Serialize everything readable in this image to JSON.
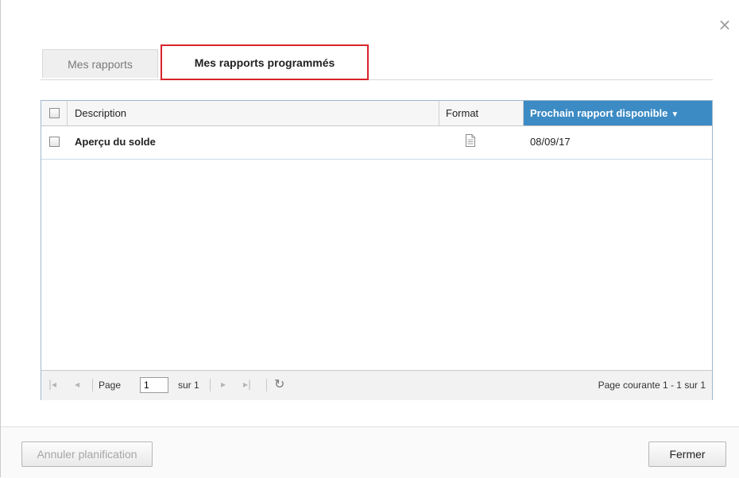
{
  "dialog": {
    "close_glyph": "×"
  },
  "tabs": [
    {
      "label": "Mes rapports",
      "active": false
    },
    {
      "label": "Mes rapports programmés",
      "active": true
    }
  ],
  "grid": {
    "columns": {
      "description": "Description",
      "format": "Format",
      "next_report": "Prochain rapport disponible",
      "sort_glyph": "▼"
    },
    "rows": [
      {
        "description": "Aperçu du solde",
        "format_icon": "document-icon",
        "next_report": "08/09/17",
        "checked": false
      }
    ]
  },
  "pager": {
    "first_glyph": "|◂",
    "prev_glyph": "◂",
    "next_glyph": "▸",
    "last_glyph": "▸|",
    "refresh_glyph": "↻",
    "page_label": "Page",
    "page_value": "1",
    "of_label": "sur 1",
    "info": "Page courante 1 - 1 sur 1"
  },
  "footer": {
    "cancel_schedule_label": "Annuler planification",
    "close_label": "Fermer"
  },
  "colors": {
    "accent": "#3c8bc4",
    "active_tab_border": "#d8232a"
  }
}
